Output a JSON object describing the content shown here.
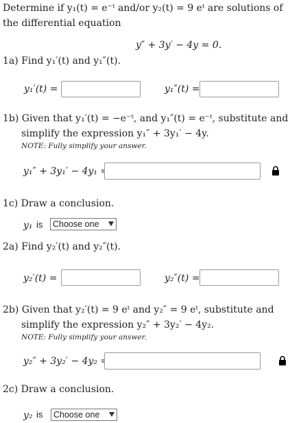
{
  "intro": {
    "line1": "Determine if y₁(t) = e⁻ᵗ and/or y₂(t) = 9 eᵗ are solutions of",
    "line2": "the differential equation",
    "equation": "y″ + 3y′ − 4y = 0."
  },
  "q1a": {
    "text": "1a) Find y₁′(t) and y₁″(t).",
    "label_a": "y₁′(t) =",
    "label_b": "y₁″(t) ="
  },
  "q1b": {
    "line1": "1b) Given that y₁′(t) = −e⁻ᵗ, and y₁″(t) = e⁻ᵗ, substitute and",
    "line2": "simplify the expression y₁″ + 3y₁′ − 4y.",
    "note": "NOTE: Fully simplify your answer.",
    "label": "y₁″ + 3y₁′ − 4y₁ ="
  },
  "q1c": {
    "text": "1c) Draw a conclusion.",
    "subject": "y₁",
    "is": "is",
    "select_value": "Choose one"
  },
  "q2a": {
    "text": "2a) Find y₂′(t) and y₂″(t).",
    "label_a": "y₂′(t) =",
    "label_b": "y₂″(t) ="
  },
  "q2b": {
    "line1": "2b) Given that y₂′(t) = 9 eᵗ and y₂″ = 9 eᵗ, substitute and",
    "line2": "simplify the expression y₂″ + 3y₂′ − 4y₂.",
    "note": "NOTE: Fully simplify your answer.",
    "label": "y₂″ + 3y₂′ − 4y₂ ="
  },
  "q2c": {
    "text": "2c) Draw a conclusion.",
    "subject": "y₂",
    "is": "is",
    "select_value": "Choose one"
  },
  "icons": {
    "lock": "lock-icon",
    "dropdown": "chevron-down-icon"
  }
}
